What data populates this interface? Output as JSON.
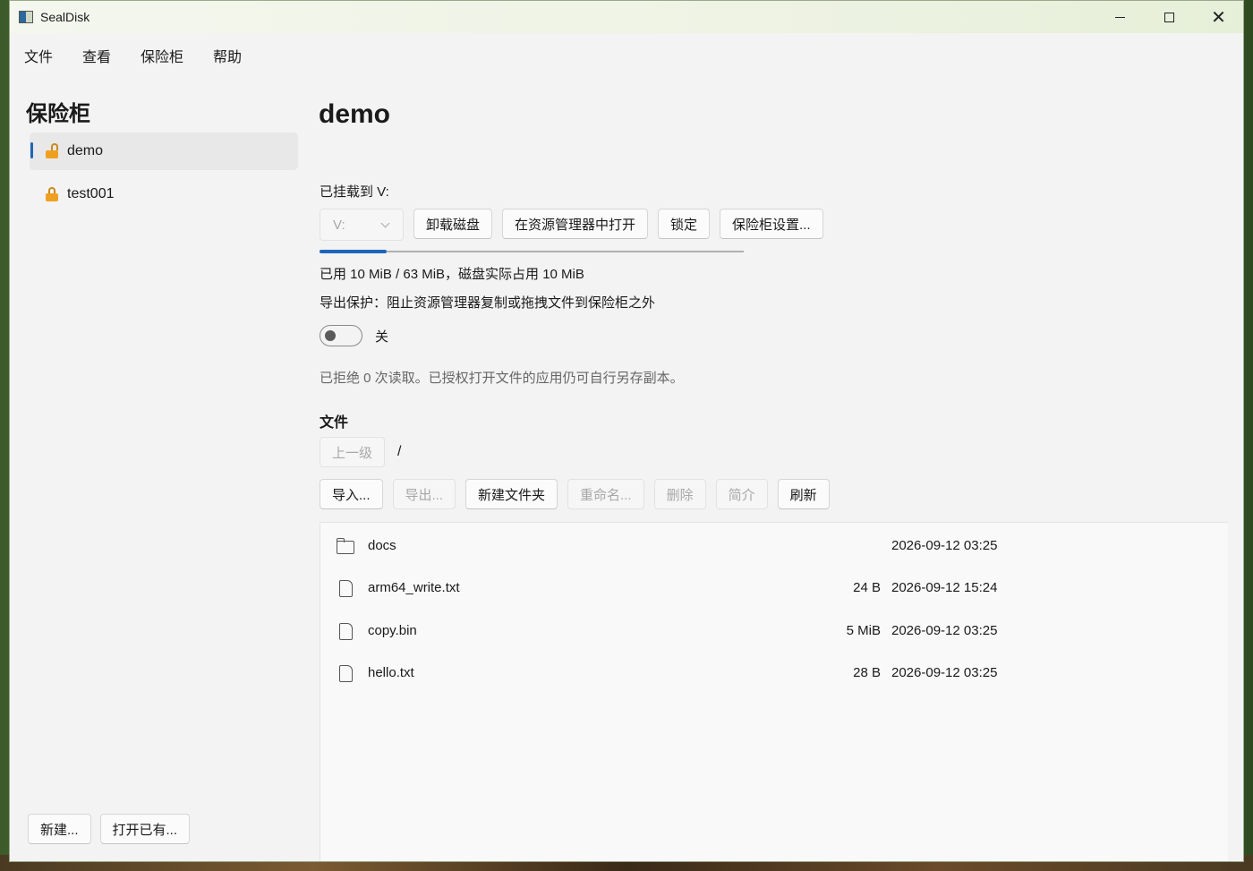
{
  "window": {
    "title": "SealDisk"
  },
  "menu": [
    "文件",
    "查看",
    "保险柜",
    "帮助"
  ],
  "sidebar": {
    "title": "保险柜",
    "vaults": [
      {
        "name": "demo",
        "state": "unlocked",
        "selected": true
      },
      {
        "name": "test001",
        "state": "locked",
        "selected": false
      }
    ],
    "new_label": "新建...",
    "open_label": "打开已有..."
  },
  "main": {
    "title": "demo",
    "mounted_label": "已挂载到 V:",
    "drive_value": "V:",
    "buttons": {
      "unmount": "卸载磁盘",
      "open_explorer": "在资源管理器中打开",
      "lock": "锁定",
      "settings": "保险柜设置..."
    },
    "usage": {
      "used_mib": 10,
      "total_mib": 63,
      "text": "已用 10 MiB / 63 MiB，磁盘实际占用 10 MiB"
    },
    "protect_text": "导出保护：阻止资源管理器复制或拖拽文件到保险柜之外",
    "toggle": {
      "on": false,
      "label": "关"
    },
    "denied_text": "已拒绝 0 次读取。已授权打开文件的应用仍可自行另存副本。",
    "files_heading": "文件",
    "up_label": "上一级",
    "path": "/",
    "toolbar": {
      "import": "导入...",
      "export": "导出...",
      "new_folder": "新建文件夹",
      "rename": "重命名...",
      "delete": "删除",
      "info": "简介",
      "refresh": "刷新"
    },
    "files": [
      {
        "name": "docs",
        "type": "folder-icon",
        "size": "",
        "date": "2026-09-12 03:25"
      },
      {
        "name": "arm64_write.txt",
        "type": "file-icon",
        "size": "24 B",
        "date": "2026-09-12 15:24"
      },
      {
        "name": "copy.bin",
        "type": "file-icon",
        "size": "5 MiB",
        "date": "2026-09-12 03:25"
      },
      {
        "name": "hello.txt",
        "type": "file-icon",
        "size": "28 B",
        "date": "2026-09-12 03:25"
      }
    ]
  },
  "colors": {
    "accent": "#1d66b8",
    "lock": "#f0a020"
  }
}
